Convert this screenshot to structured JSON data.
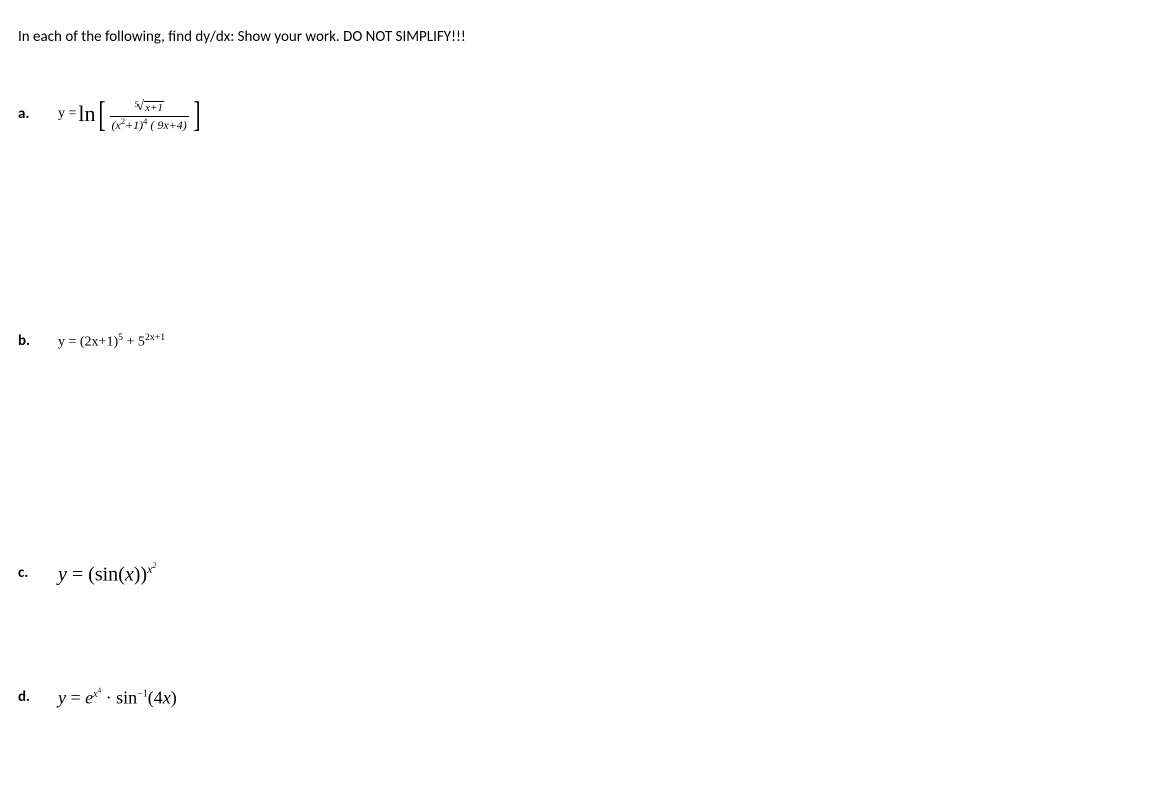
{
  "instruction": "In each of the following, find dy/dx: Show your work.  DO NOT SIMPLIFY!!!",
  "problems": {
    "a": {
      "label": "a.",
      "y_eq": "y = ",
      "ln": "ln",
      "root_index": "5",
      "radicand": "x+1",
      "denominator": "(x²+1)⁴ ( 9x+4)"
    },
    "b": {
      "label": "b.",
      "text": "y = (2x+1)⁵ + 5²ˣ⁺¹"
    },
    "c": {
      "label": "c.",
      "y": "y",
      "eq": " = ",
      "lparen": "(",
      "sin": "sin",
      "lparen2": "(",
      "x": "x",
      "rparen2": ")",
      "rparen": ")",
      "exp_base": "x",
      "exp_exp": "2"
    },
    "d": {
      "label": "d.",
      "y": "y",
      "eq": " = ",
      "e": "e",
      "exp_x": "x",
      "exp_4": "4",
      "dot": " · ",
      "sin": "sin",
      "neg1": "−1",
      "lparen": "(",
      "four_x": "4x",
      "rparen": ")"
    }
  }
}
